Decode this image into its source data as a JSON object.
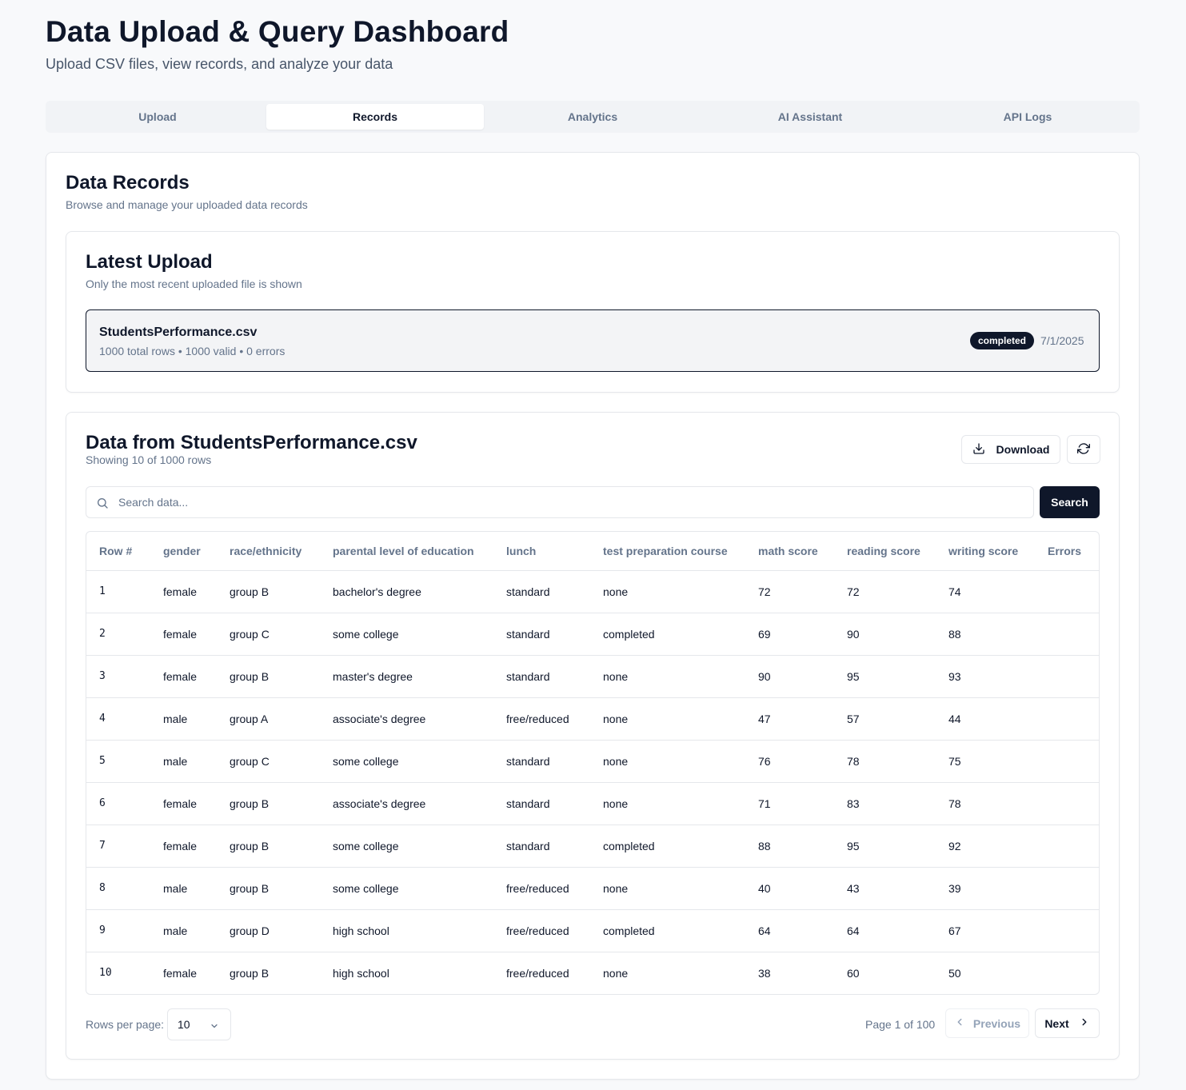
{
  "header": {
    "title": "Data Upload & Query Dashboard",
    "subtitle": "Upload CSV files, view records, and analyze your data"
  },
  "tabs": [
    {
      "label": "Upload",
      "active": false
    },
    {
      "label": "Records",
      "active": true
    },
    {
      "label": "Analytics",
      "active": false
    },
    {
      "label": "AI Assistant",
      "active": false
    },
    {
      "label": "API Logs",
      "active": false
    }
  ],
  "records": {
    "title": "Data Records",
    "subtitle": "Browse and manage your uploaded data records"
  },
  "latest": {
    "title": "Latest Upload",
    "subtitle": "Only the most recent uploaded file is shown",
    "file_name": "StudentsPerformance.csv",
    "stats": "1000 total rows • 1000 valid • 0 errors",
    "status": "completed",
    "date": "7/1/2025"
  },
  "data": {
    "title": "Data from StudentsPerformance.csv",
    "subtitle": "Showing 10 of 1000 rows",
    "download_label": "Download",
    "search_placeholder": "Search data...",
    "search_label": "Search",
    "columns": [
      "Row #",
      "gender",
      "race/ethnicity",
      "parental level of education",
      "lunch",
      "test preparation course",
      "math score",
      "reading score",
      "writing score",
      "Errors"
    ],
    "rows": [
      [
        "1",
        "female",
        "group B",
        "bachelor's degree",
        "standard",
        "none",
        "72",
        "72",
        "74",
        ""
      ],
      [
        "2",
        "female",
        "group C",
        "some college",
        "standard",
        "completed",
        "69",
        "90",
        "88",
        ""
      ],
      [
        "3",
        "female",
        "group B",
        "master's degree",
        "standard",
        "none",
        "90",
        "95",
        "93",
        ""
      ],
      [
        "4",
        "male",
        "group A",
        "associate's degree",
        "free/reduced",
        "none",
        "47",
        "57",
        "44",
        ""
      ],
      [
        "5",
        "male",
        "group C",
        "some college",
        "standard",
        "none",
        "76",
        "78",
        "75",
        ""
      ],
      [
        "6",
        "female",
        "group B",
        "associate's degree",
        "standard",
        "none",
        "71",
        "83",
        "78",
        ""
      ],
      [
        "7",
        "female",
        "group B",
        "some college",
        "standard",
        "completed",
        "88",
        "95",
        "92",
        ""
      ],
      [
        "8",
        "male",
        "group B",
        "some college",
        "free/reduced",
        "none",
        "40",
        "43",
        "39",
        ""
      ],
      [
        "9",
        "male",
        "group D",
        "high school",
        "free/reduced",
        "completed",
        "64",
        "64",
        "67",
        ""
      ],
      [
        "10",
        "female",
        "group B",
        "high school",
        "free/reduced",
        "none",
        "38",
        "60",
        "50",
        ""
      ]
    ],
    "rows_per_page_label": "Rows per page:",
    "rows_per_page_value": "10",
    "page_info": "Page 1 of 100",
    "previous_label": "Previous",
    "next_label": "Next"
  },
  "colors": {
    "accent": "#0f172a",
    "muted_text": "#64748b",
    "border": "#e5e7eb",
    "background": "#f8f9fb"
  },
  "icons": [
    "download-icon",
    "refresh-icon",
    "search-icon",
    "chevron-down-icon",
    "chevron-left-icon",
    "chevron-right-icon"
  ]
}
